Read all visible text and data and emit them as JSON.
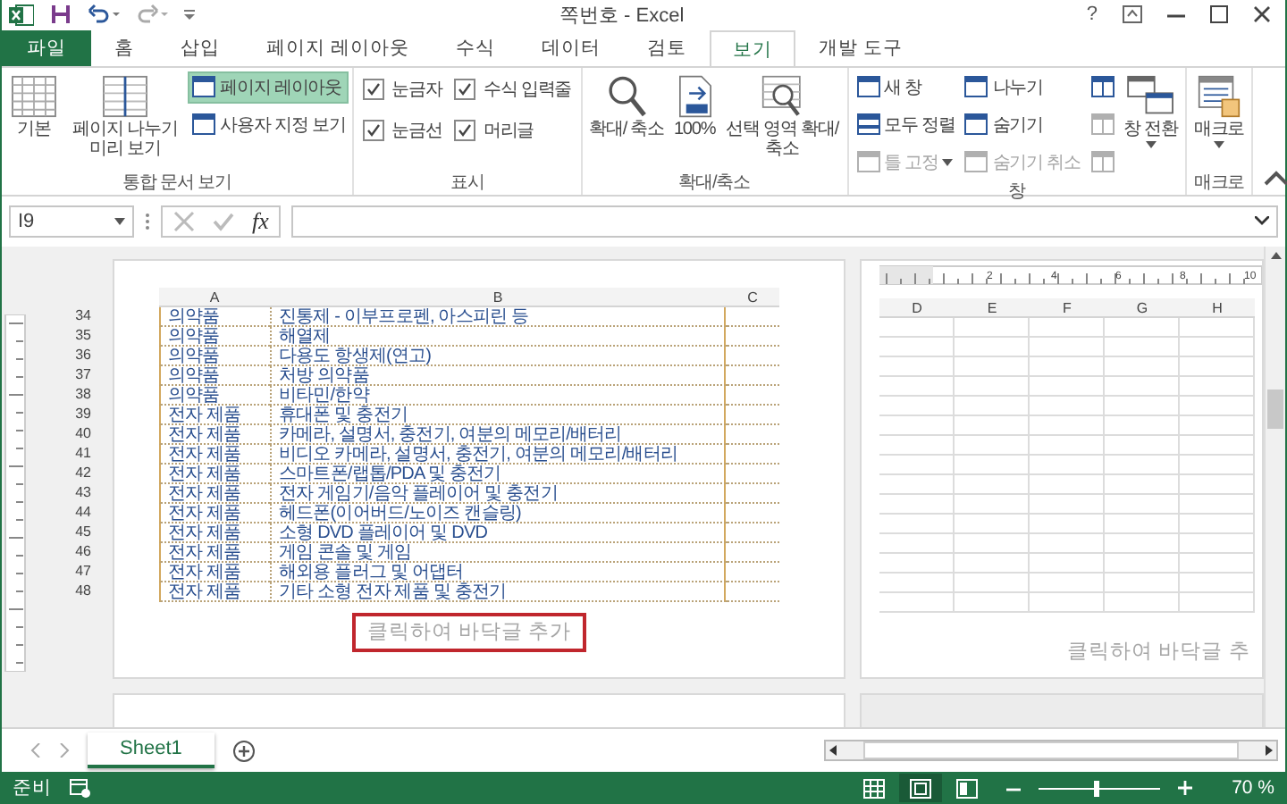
{
  "window": {
    "title": "쪽번호 - Excel",
    "help": "?"
  },
  "ribbon_tabs": [
    {
      "label": "파일",
      "kind": "file",
      "selected": false
    },
    {
      "label": "홈",
      "kind": "tab",
      "selected": false
    },
    {
      "label": "삽입",
      "kind": "tab",
      "selected": false
    },
    {
      "label": "페이지 레이아웃",
      "kind": "tab",
      "selected": false
    },
    {
      "label": "수식",
      "kind": "tab",
      "selected": false
    },
    {
      "label": "데이터",
      "kind": "tab",
      "selected": false
    },
    {
      "label": "검토",
      "kind": "tab",
      "selected": false
    },
    {
      "label": "보기",
      "kind": "tab",
      "selected": true
    },
    {
      "label": "개발 도구",
      "kind": "tab",
      "selected": false
    }
  ],
  "ribbon": {
    "groups": [
      {
        "label": "통합 문서 보기",
        "columns": [
          [
            {
              "kind": "large",
              "label": "기본",
              "selected": false
            }
          ],
          [
            {
              "kind": "large",
              "label": "페이지 나누기 미리 보기",
              "selected": false
            }
          ],
          [
            {
              "kind": "small",
              "label": "페이지 레이아웃",
              "selected": true
            },
            {
              "kind": "small",
              "label": "사용자 지정 보기"
            }
          ]
        ]
      },
      {
        "label": "표시",
        "columns": [
          [
            {
              "kind": "check",
              "label": "눈금자",
              "checked": true
            },
            {
              "kind": "check",
              "label": "눈금선",
              "checked": true
            }
          ],
          [
            {
              "kind": "check",
              "label": "수식 입력줄",
              "checked": true
            },
            {
              "kind": "check",
              "label": "머리글",
              "checked": true
            }
          ]
        ]
      },
      {
        "label": "확대/축소",
        "columns": [
          [
            {
              "kind": "large",
              "label": "확대/ 축소"
            }
          ],
          [
            {
              "kind": "large",
              "label": "100%"
            }
          ],
          [
            {
              "kind": "large",
              "label": "선택 영역 확대/축소"
            }
          ]
        ]
      },
      {
        "label": "창",
        "columns": [
          [
            {
              "kind": "small",
              "label": "새 창"
            },
            {
              "kind": "small",
              "label": "모두 정렬"
            },
            {
              "kind": "small",
              "label": "틀 고정",
              "disabled": true,
              "dropdown": true
            }
          ],
          [
            {
              "kind": "small",
              "label": "나누기"
            },
            {
              "kind": "small",
              "label": "숨기기"
            },
            {
              "kind": "small",
              "label": "숨기기 취소",
              "disabled": true
            }
          ],
          [
            {
              "kind": "icon"
            },
            {
              "kind": "icon",
              "disabled": true
            },
            {
              "kind": "icon",
              "disabled": true
            }
          ],
          [
            {
              "kind": "large",
              "label": "창 전환",
              "dropdown": true
            }
          ]
        ]
      },
      {
        "label": "매크로",
        "columns": [
          [
            {
              "kind": "large",
              "label": "매크로",
              "dropdown": true
            }
          ]
        ]
      }
    ]
  },
  "formula_bar": {
    "name_box": "I9",
    "function_label": "fx"
  },
  "sheet": {
    "ruler_labels": [
      "2",
      "4",
      "6",
      "8",
      "10"
    ],
    "page_1": {
      "columns": [
        "A",
        "B",
        "C"
      ],
      "footer": "클릭하여 바닥글 추가",
      "footer_highlighted": true
    },
    "page_2": {
      "columns": [
        "D",
        "E",
        "F",
        "G",
        "H"
      ],
      "footer": "클릭하여 바닥글 추"
    },
    "rows": [
      {
        "number": "34",
        "cells": [
          "의약품",
          "진통제 - 이부프로펜, 아스피린 등"
        ]
      },
      {
        "number": "35",
        "cells": [
          "의약품",
          "해열제"
        ]
      },
      {
        "number": "36",
        "cells": [
          "의약품",
          "다용도 항생제(연고)"
        ]
      },
      {
        "number": "37",
        "cells": [
          "의약품",
          "처방 의약품"
        ]
      },
      {
        "number": "38",
        "cells": [
          "의약품",
          "비타민/한약"
        ]
      },
      {
        "number": "39",
        "cells": [
          "전자 제품",
          "휴대폰 및 충전기"
        ]
      },
      {
        "number": "40",
        "cells": [
          "전자 제품",
          "카메라, 설명서, 충전기, 여분의 메모리/배터리"
        ]
      },
      {
        "number": "41",
        "cells": [
          "전자 제품",
          "비디오 카메라, 설명서, 충전기, 여분의 메모리/배터리"
        ]
      },
      {
        "number": "42",
        "cells": [
          "전자 제품",
          "스마트폰/랩톱/PDA 및 충전기"
        ]
      },
      {
        "number": "43",
        "cells": [
          "전자 제품",
          "전자 게임기/음악 플레이어 및 충전기"
        ]
      },
      {
        "number": "44",
        "cells": [
          "전자 제품",
          "헤드폰(이어버드/노이즈 캔슬링)"
        ]
      },
      {
        "number": "45",
        "cells": [
          "전자 제품",
          "소형 DVD 플레이어 및 DVD"
        ]
      },
      {
        "number": "46",
        "cells": [
          "전자 제품",
          "게임 콘솔 및 게임"
        ]
      },
      {
        "number": "47",
        "cells": [
          "전자 제품",
          "해외용 플러그 및 어댑터"
        ]
      },
      {
        "number": "48",
        "cells": [
          "전자 제품",
          "기타 소형 전자 제품 및 충전기"
        ]
      }
    ]
  },
  "sheet_tabs": [
    {
      "label": "Sheet1",
      "selected": true
    }
  ],
  "status_bar": {
    "status": "준비",
    "view_buttons": [
      {
        "selected": false
      },
      {
        "selected": true
      },
      {
        "selected": false
      }
    ],
    "zoom": {
      "level": 0.45
    },
    "zoom_label": "70 %"
  }
}
